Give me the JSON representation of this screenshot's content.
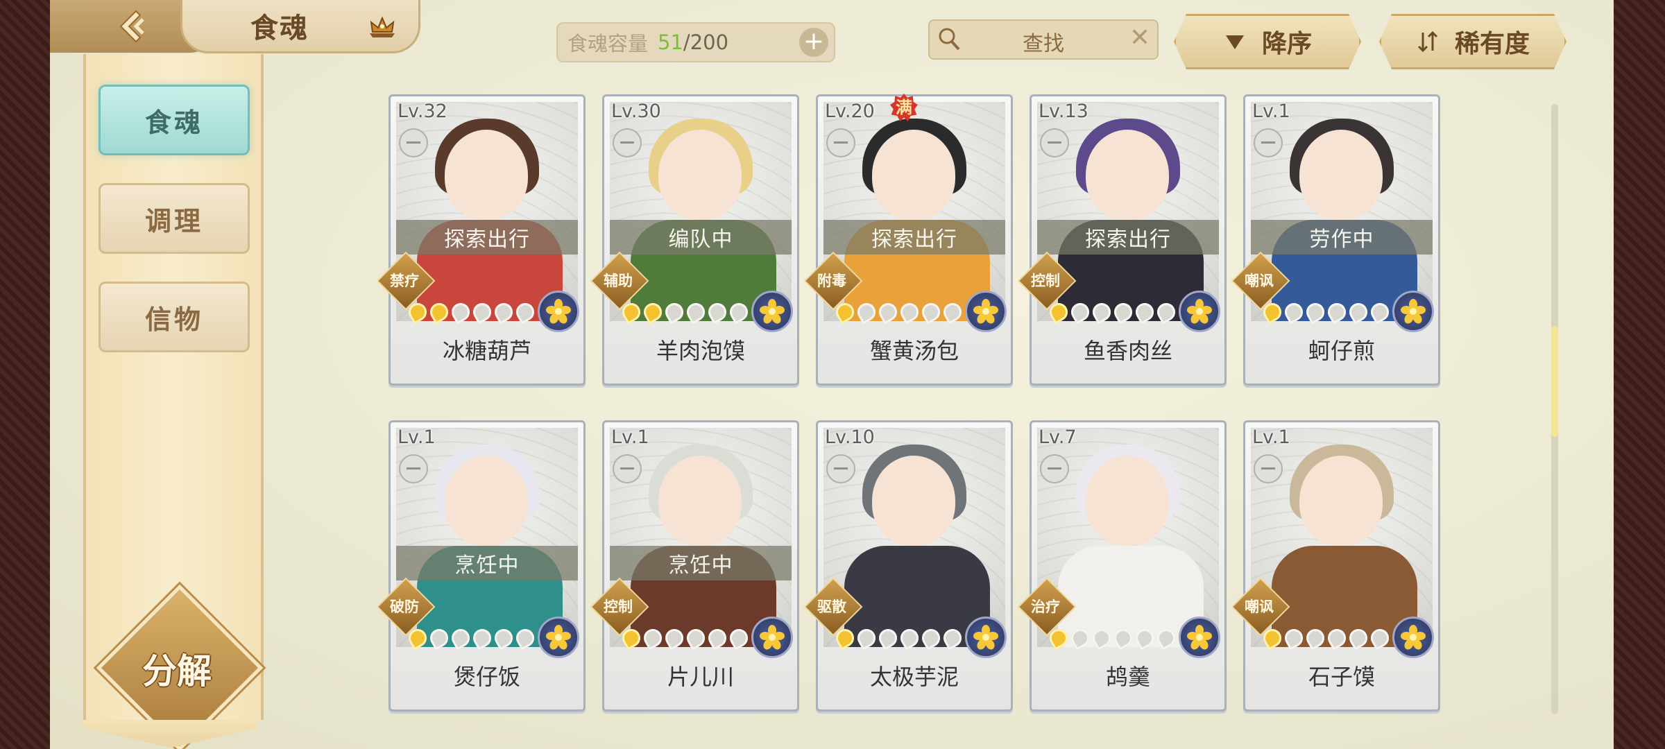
{
  "header": {
    "title": "食魂",
    "capacity_label": "食魂容量",
    "capacity_current": "51",
    "capacity_max": "/200",
    "search_placeholder": "查找",
    "sort_label": "降序",
    "rarity_label": "稀有度"
  },
  "sidebar": {
    "items": [
      {
        "label": "食魂",
        "active": true
      },
      {
        "label": "调理",
        "active": false
      },
      {
        "label": "信物",
        "active": false
      }
    ],
    "decompose_label": "分解"
  },
  "cards": [
    {
      "level": "Lv.32",
      "status": "探索出行",
      "role": "禁疗",
      "stars": 2,
      "name": "冰糖葫芦",
      "hair": "#5a3a2a",
      "body": "#c8463c",
      "full": false
    },
    {
      "level": "Lv.30",
      "status": "编队中",
      "role": "辅助",
      "stars": 2,
      "name": "羊肉泡馍",
      "hair": "#e8d089",
      "body": "#4f7b3b",
      "full": false
    },
    {
      "level": "Lv.20",
      "status": "探索出行",
      "role": "附毒",
      "stars": 1,
      "name": "蟹黄汤包",
      "hair": "#2b2b2b",
      "body": "#e9a23a",
      "full": true,
      "full_label": "满"
    },
    {
      "level": "Lv.13",
      "status": "探索出行",
      "role": "控制",
      "stars": 1,
      "name": "鱼香肉丝",
      "hair": "#5d4a8a",
      "body": "#2e2a36",
      "full": false
    },
    {
      "level": "Lv.1",
      "status": "劳作中",
      "role": "嘲讽",
      "stars": 1,
      "name": "蚵仔煎",
      "hair": "#3a3434",
      "body": "#345a9a",
      "full": false
    },
    {
      "level": "Lv.1",
      "status": "烹饪中",
      "role": "破防",
      "stars": 1,
      "name": "煲仔饭",
      "hair": "#e8e6ef",
      "body": "#2f8f8a",
      "full": false
    },
    {
      "level": "Lv.1",
      "status": "烹饪中",
      "role": "控制",
      "stars": 1,
      "name": "片儿川",
      "hair": "#dcdcd6",
      "body": "#6b3a2a",
      "full": false
    },
    {
      "level": "Lv.10",
      "status": "",
      "role": "驱散",
      "stars": 1,
      "name": "太极芋泥",
      "hair": "#6f7478",
      "body": "#3a3a44",
      "full": false
    },
    {
      "level": "Lv.7",
      "status": "",
      "role": "治疗",
      "stars": 1,
      "name": "鸪羹",
      "hair": "#ece8f0",
      "body": "#f2f0ec",
      "full": false
    },
    {
      "level": "Lv.1",
      "status": "",
      "role": "嘲讽",
      "stars": 1,
      "name": "石子馍",
      "hair": "#c9b899",
      "body": "#8a5a35",
      "full": false
    }
  ],
  "icons": {
    "back": "back-arrow-icon",
    "crown": "crown-icon",
    "search": "search-icon",
    "clear": "close-icon",
    "sort": "triangle-down-icon",
    "rarity": "sort-arrows-icon",
    "element": "flower-element-icon"
  },
  "colors": {
    "active_tab": "#9fd9d3",
    "star_on": "#f2c230",
    "capacity_current": "#7ac03a"
  }
}
